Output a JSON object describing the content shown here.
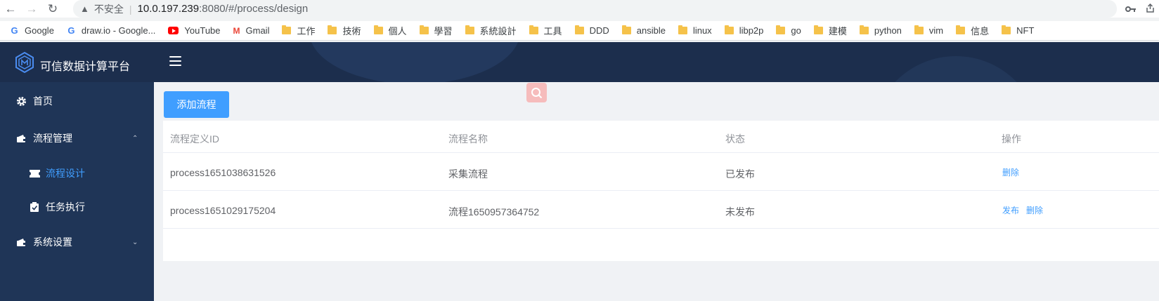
{
  "browser": {
    "insecure_label": "不安全",
    "url_host": "10.0.197.239",
    "url_rest": ":8080/#/process/design"
  },
  "bookmarks": [
    {
      "label": "Google",
      "icon": "google-icon"
    },
    {
      "label": "draw.io - Google...",
      "icon": "google-icon"
    },
    {
      "label": "YouTube",
      "icon": "youtube-icon"
    },
    {
      "label": "Gmail",
      "icon": "gmail-icon"
    },
    {
      "label": "工作",
      "icon": "folder-icon"
    },
    {
      "label": "技術",
      "icon": "folder-icon"
    },
    {
      "label": "個人",
      "icon": "folder-icon"
    },
    {
      "label": "學習",
      "icon": "folder-icon"
    },
    {
      "label": "系統設計",
      "icon": "folder-icon"
    },
    {
      "label": "工具",
      "icon": "folder-icon"
    },
    {
      "label": "DDD",
      "icon": "folder-icon"
    },
    {
      "label": "ansible",
      "icon": "folder-icon"
    },
    {
      "label": "linux",
      "icon": "folder-icon"
    },
    {
      "label": "libp2p",
      "icon": "folder-icon"
    },
    {
      "label": "go",
      "icon": "folder-icon"
    },
    {
      "label": "建模",
      "icon": "folder-icon"
    },
    {
      "label": "python",
      "icon": "folder-icon"
    },
    {
      "label": "vim",
      "icon": "folder-icon"
    },
    {
      "label": "信息",
      "icon": "folder-icon"
    },
    {
      "label": "NFT",
      "icon": "folder-icon"
    }
  ],
  "app": {
    "title": "可信数据计算平台"
  },
  "sidebar": {
    "home": "首页",
    "process_mgmt": "流程管理",
    "process_design": "流程设计",
    "task_exec": "任务执行",
    "system_settings": "系统设置"
  },
  "main": {
    "add_button": "添加流程",
    "table": {
      "headers": [
        "流程定义ID",
        "流程名称",
        "状态",
        "操作"
      ],
      "rows": [
        {
          "id": "process1651038631526",
          "name": "采集流程",
          "status": "已发布",
          "actions": [
            "删除"
          ]
        },
        {
          "id": "process1651029175204",
          "name": "流程1650957364752",
          "status": "未发布",
          "actions": [
            "发布",
            "删除"
          ]
        }
      ]
    }
  },
  "colors": {
    "header_bg": "#1c2e4d",
    "sidebar_bg": "#1f3557",
    "accent": "#409eff"
  }
}
